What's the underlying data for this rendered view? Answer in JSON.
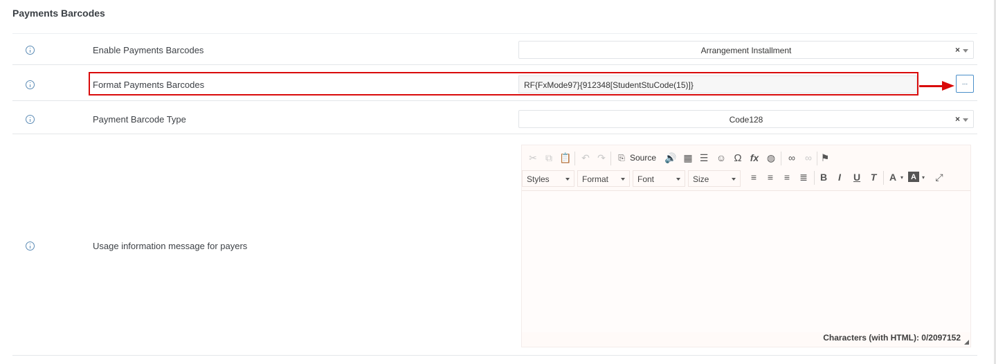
{
  "section": {
    "title": "Payments Barcodes"
  },
  "rows": {
    "enable": {
      "label": "Enable Payments Barcodes",
      "value": "Arrangement Installment",
      "clear": "×"
    },
    "format": {
      "label": "Format Payments Barcodes",
      "value": "RF{FxMode97}{912348[StudentStuCode(15)]}",
      "button": "..."
    },
    "type": {
      "label": "Payment Barcode Type",
      "value": "Code128",
      "clear": "×"
    },
    "usage": {
      "label": "Usage information message for payers"
    }
  },
  "editor": {
    "source_label": "Source",
    "combos": [
      "Styles",
      "Format",
      "Font",
      "Size"
    ],
    "char_counter": "Characters (with HTML): 0/2097152",
    "toolbar_icons": [
      "cut-icon",
      "copy-icon",
      "paste-icon",
      "undo-icon",
      "redo-icon",
      "source-icon",
      "audio-icon",
      "table-icon",
      "horizontal-rule-icon",
      "smiley-icon",
      "omega-icon",
      "formula-icon",
      "globe-icon",
      "link-icon",
      "unlink-icon",
      "flag-icon",
      "align-left-icon",
      "align-center-icon",
      "align-right-icon",
      "justify-icon",
      "bold-icon",
      "italic-icon",
      "underline-icon",
      "remove-format-icon",
      "text-color-icon",
      "background-color-icon",
      "maximize-icon"
    ],
    "glyphs": {
      "bold": "B",
      "italic": "I",
      "underline": "U",
      "removeformat": "T",
      "textcolor": "A",
      "bgcolor": "A"
    }
  },
  "colors": {
    "highlight": "#d90a0a",
    "accent": "#4a8fc9",
    "info_icon": "#5b8bb5"
  }
}
